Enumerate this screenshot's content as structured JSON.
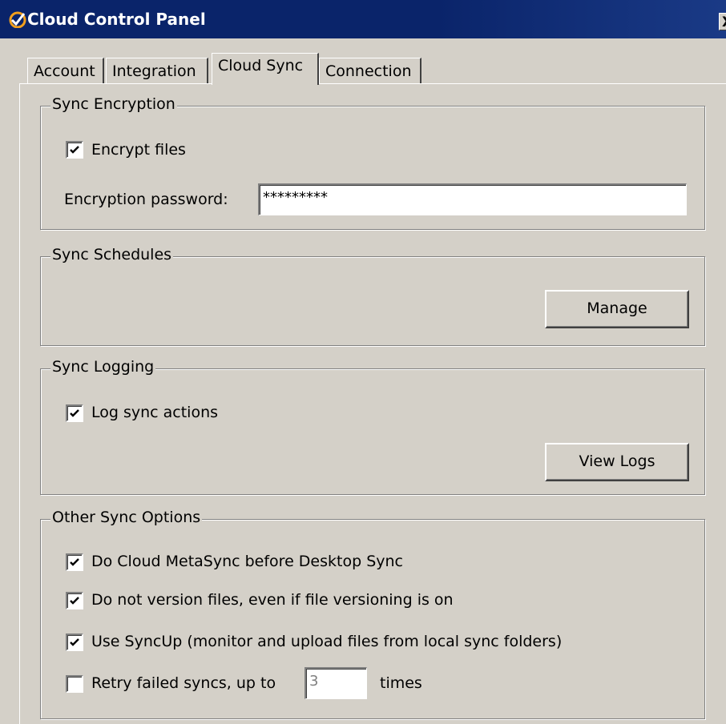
{
  "window": {
    "title": "Cloud Control Panel",
    "close_glyph": "X"
  },
  "tabs": [
    {
      "label": "Account",
      "selected": false
    },
    {
      "label": "Integration",
      "selected": false
    },
    {
      "label": "Cloud Sync",
      "selected": true
    },
    {
      "label": "Connection",
      "selected": false
    }
  ],
  "encryption": {
    "legend": "Sync Encryption",
    "encrypt_files": {
      "label": "Encrypt files",
      "checked": true
    },
    "password_label": "Encryption password:",
    "password_value": "*********"
  },
  "schedules": {
    "legend": "Sync Schedules",
    "manage_label": "Manage"
  },
  "logging": {
    "legend": "Sync Logging",
    "log_actions": {
      "label": "Log sync actions",
      "checked": true
    },
    "view_logs_label": "View Logs"
  },
  "other": {
    "legend": "Other Sync Options",
    "metasync": {
      "label": "Do Cloud MetaSync before Desktop Sync",
      "checked": true
    },
    "no_version": {
      "label": "Do not version files, even if file versioning is on",
      "checked": true
    },
    "syncup": {
      "label": "Use SyncUp (monitor and upload files from local sync folders)",
      "checked": true
    },
    "retry": {
      "label": "Retry failed syncs, up to",
      "checked": false,
      "count": "3",
      "suffix": "times"
    }
  }
}
